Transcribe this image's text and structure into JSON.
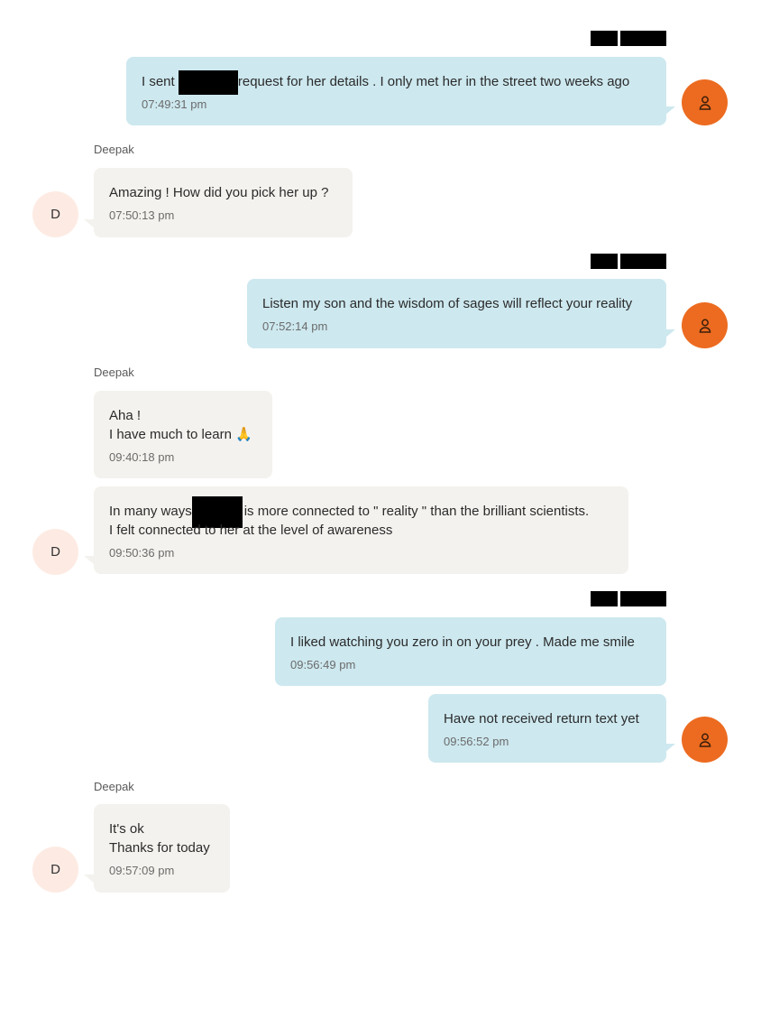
{
  "me": {
    "avatar_icon": "person-icon",
    "avatar_color": "#ec6b20"
  },
  "other": {
    "name": "Deepak",
    "initial": "D"
  },
  "messages": [
    {
      "pre": "I sent ",
      "post": "request for her details . I only met her in the street two weeks ago",
      "time": "07:49:31 pm"
    },
    {
      "text": "Amazing ! How did you pick her up ?",
      "time": "07:50:13 pm"
    },
    {
      "text": "Listen my son and the wisdom of sages will reflect your reality",
      "time": "07:52:14 pm"
    },
    {
      "text": "Aha !\nI have much to learn 🙏",
      "time": "09:40:18 pm"
    },
    {
      "pre": "In many ways",
      "post": "is more connected to \" reality \" than the brilliant scientists.",
      "line2": "I felt connected to her at the level of awareness",
      "time": "09:50:36 pm"
    },
    {
      "text": "I liked watching you zero in on your prey . Made me smile",
      "time": "09:56:49 pm"
    },
    {
      "text": "Have not received return text yet",
      "time": "09:56:52 pm"
    },
    {
      "text": "It's ok\nThanks for today",
      "time": "09:57:09 pm"
    }
  ],
  "colors": {
    "outgoing_bubble": "#cde8ef",
    "incoming_bubble": "#f4f2ee",
    "incoming_avatar": "#fdebe3"
  }
}
